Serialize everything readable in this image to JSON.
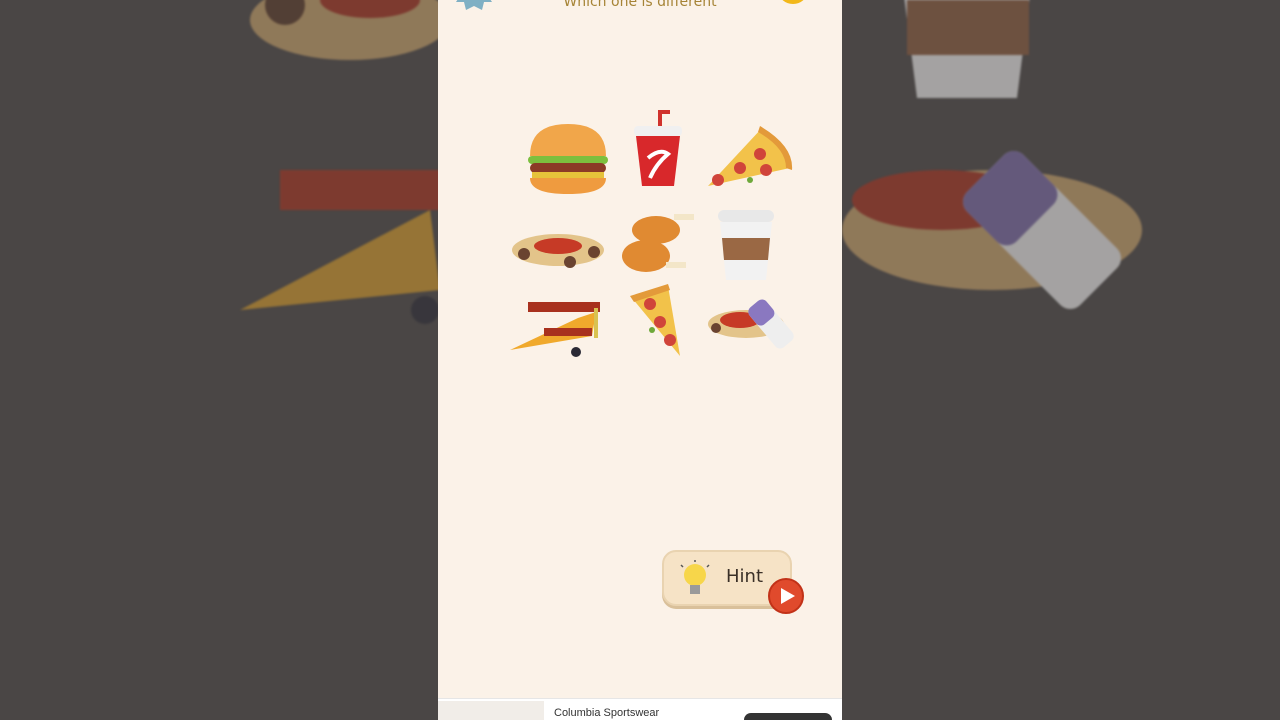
{
  "game": {
    "title": "Which one is different",
    "items": [
      {
        "icon": "burger-icon"
      },
      {
        "icon": "soda-cup-icon"
      },
      {
        "icon": "pizza-slice-icon"
      },
      {
        "icon": "spaghetti-icon"
      },
      {
        "icon": "chicken-drumstick-icon"
      },
      {
        "icon": "coffee-cup-icon"
      },
      {
        "icon": "biplane-icon"
      },
      {
        "icon": "pizza-slice-icon"
      },
      {
        "icon": "spaghetti-eraser-icon"
      }
    ]
  },
  "hint": {
    "label": "Hint"
  },
  "ad": {
    "title": "Columbia Sportswear"
  },
  "colors": {
    "panel_bg": "#fbf2e8",
    "title": "#a68436",
    "backdrop": "#4a4645",
    "play_red": "#e04a2c"
  }
}
